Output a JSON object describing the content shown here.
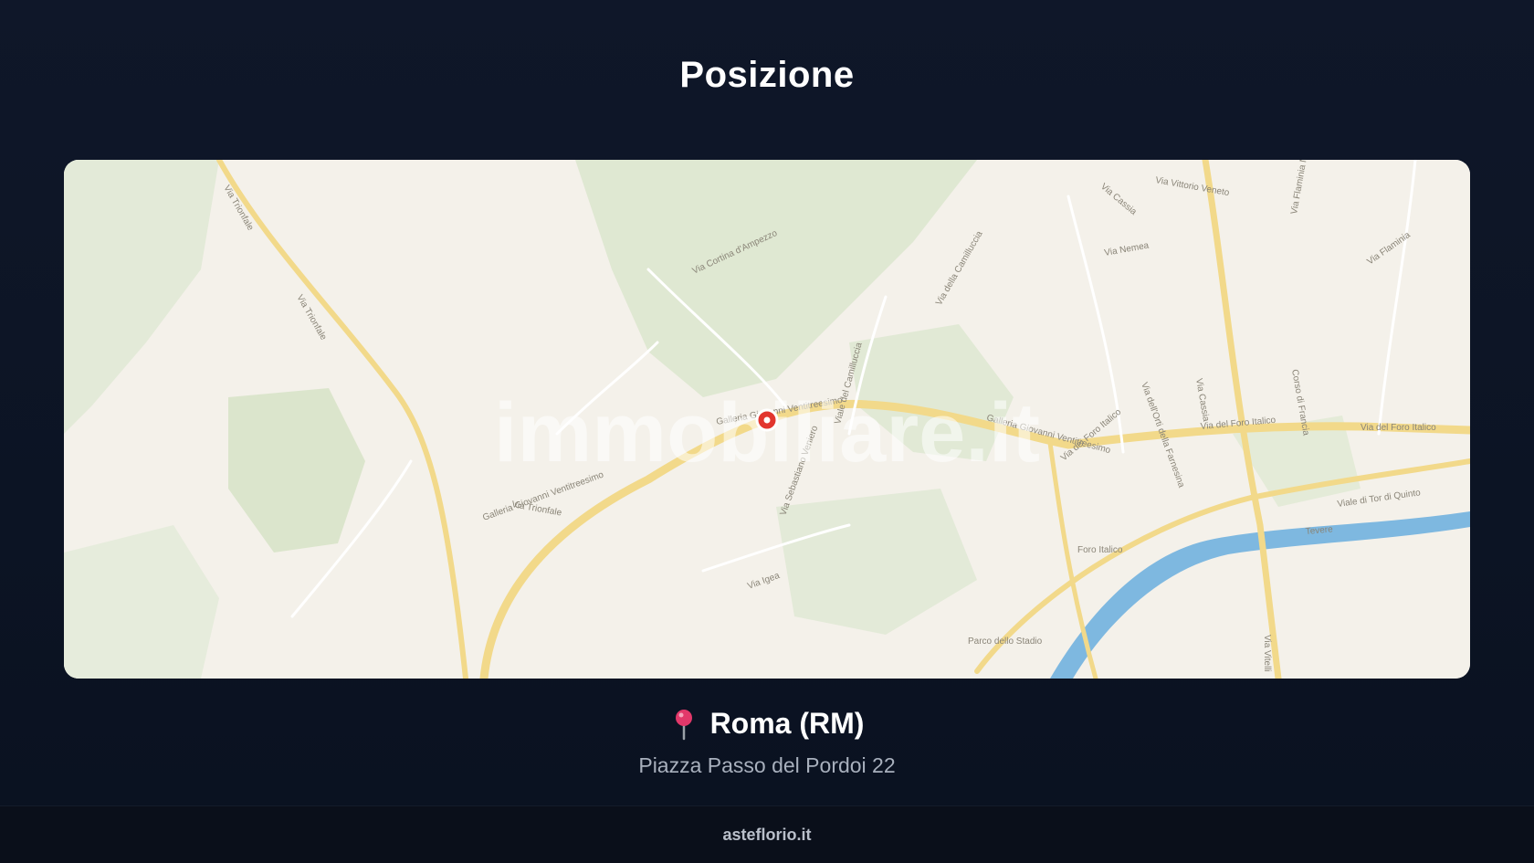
{
  "header": {
    "title": "Posizione"
  },
  "map": {
    "watermark": "immobiliare.it",
    "street_labels": [
      "Via Trionfale",
      "Via Trionfale",
      "Via Cortina d'Ampezzo",
      "Via della Camilluccia",
      "Via Cassia",
      "Via Vittorio Veneto",
      "Via Nemea",
      "Via Flaminia Nuova",
      "Via Flaminia",
      "Galleria Giovanni Ventitreesimo",
      "Galleria Giovanni Ventitreesimo",
      "Galleria Giovanni Ventitreesimo",
      "Via Trionfale",
      "Via dei Foro Italico",
      "Via del Foro Italico",
      "Via del Foro Italico",
      "Viale di Tor di Quinto",
      "Via Igea",
      "Via Sebastiano Veniero",
      "Viale del Camilluccia",
      "Via Cassia",
      "Via dell'Orti della Farnesina",
      "Corso di Francia",
      "Foro Italico",
      "Parco dello Stadio",
      "Tevere",
      "Via Vitelli"
    ]
  },
  "location": {
    "pin_icon": "pin-icon",
    "city": "Roma (RM)",
    "address": "Piazza Passo del Pordoi 22"
  },
  "footer": {
    "text": "asteflorio.it"
  },
  "colors": {
    "background": "#0f1729",
    "map_land": "#f4f1ea",
    "map_green": "#dfe8d2",
    "map_road": "#f2d98a",
    "map_river": "#7eb8e0",
    "marker": "#e2362f",
    "address_text": "#a8b0bd"
  }
}
